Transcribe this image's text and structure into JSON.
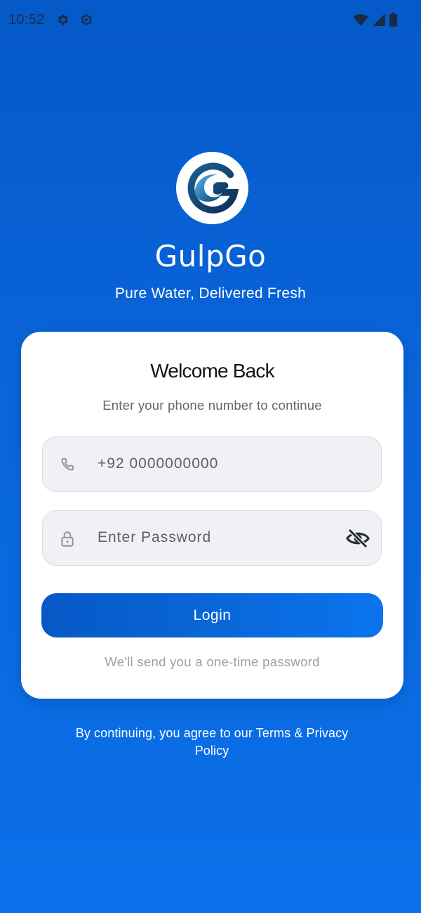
{
  "status_bar": {
    "time": "10:52"
  },
  "brand": {
    "app_name": "GulpGo",
    "tagline": "Pure Water, Delivered Fresh"
  },
  "login_card": {
    "title": "Welcome Back",
    "subtitle": "Enter your phone number to continue",
    "phone_field": {
      "value": "",
      "placeholder": "+92 0000000000"
    },
    "password_field": {
      "value": "",
      "placeholder": "Enter Password"
    },
    "login_button_label": "Login",
    "otp_hint": "We'll send you a one-time password"
  },
  "footer": {
    "terms_text": "By continuing, you agree to our Terms & Privacy Policy"
  },
  "icons": {
    "phone": "phone-icon",
    "lock": "lock-icon",
    "visibility": "eye-off-icon",
    "logo": "wave-g-logo"
  },
  "colors": {
    "background_top": "#0559c9",
    "background_bottom": "#0b70ea",
    "card": "#ffffff",
    "field_bg": "#f0f1f4",
    "button_start": "#0658c6",
    "button_end": "#0a74ee"
  }
}
